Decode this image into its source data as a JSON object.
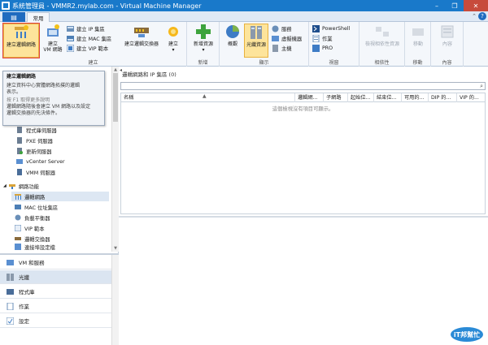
{
  "window": {
    "title": "系統管理員 - VMMR2.mylab.com - Virtual Machine Manager",
    "buttons": {
      "minimize": "–",
      "maximize": "❐",
      "close": "✕"
    }
  },
  "ribbon_tabs": {
    "file": "▤",
    "home": "常用"
  },
  "ribbon": {
    "create_group": {
      "label": "建立",
      "create_vm_network": "建立邏輯網路",
      "create_vm": [
        "建立",
        "VM 網路"
      ],
      "create_ip_pool": "建立 IP 集區",
      "create_mac_pool": "建立 MAC 集區",
      "create_vip_template": "建立 VIP 範本",
      "create_logical_switch": "建立邏輯交換器",
      "create": "建立"
    },
    "add_group": {
      "label": "新增",
      "add_resource": "新增資源"
    },
    "show_group": {
      "label": "顯示",
      "overview": "概觀",
      "fabric_resources": "光纖資源",
      "hosts_list": [
        "服務",
        "虛擬機器",
        "主機"
      ]
    },
    "window_group": {
      "label": "視窗",
      "powershell": "PowerShell",
      "jobs": "作業",
      "pro": "PRO"
    },
    "dependencies_group": {
      "label": "相依性",
      "view_dependencies": "檢視相依性資源"
    },
    "move_group": {
      "label": "移動",
      "move": "移動"
    },
    "properties_group": {
      "label": "內容",
      "properties": "內容"
    }
  },
  "tooltip": {
    "title": "建立邏輯網路",
    "line1": "建立資料中心實體網路拓撲的邏輯",
    "line1b": "表示。",
    "help": "按 F1 取得更多說明",
    "line2": "邏輯網路隨後會建立 VM 網路以及設定",
    "line3": "邏輯交換器的先決條件。"
  },
  "tree": {
    "servers": [
      "程式庫伺服器",
      "PXE 伺服器",
      "更新伺服器",
      "vCenter Server",
      "VMM 伺服器"
    ],
    "networking": "網路功能",
    "net_items": [
      "邏輯網路",
      "MAC 位址集區",
      "負載平衡器",
      "VIP 範本",
      "邏輯交換器",
      "連接埠設定檔"
    ]
  },
  "workspaces": [
    "VM 和服務",
    "光纖",
    "程式庫",
    "作業",
    "設定"
  ],
  "main": {
    "header": "邏輯網路和 IP 集區 (0)",
    "columns": [
      "名稱",
      "邏輯網...",
      "子網路",
      "起始位...",
      "結束位...",
      "可用的...",
      "DIP 的...",
      "VIP 的..."
    ],
    "empty": "這個檢視沒有項目可顯示。"
  },
  "watermark": {
    "text": "iT邦幫忙"
  },
  "colors": {
    "titlebar": "#1979ca",
    "ribbon": "#f4f7fb",
    "accent": "#1f6bbf",
    "selected": "#fde49b"
  }
}
